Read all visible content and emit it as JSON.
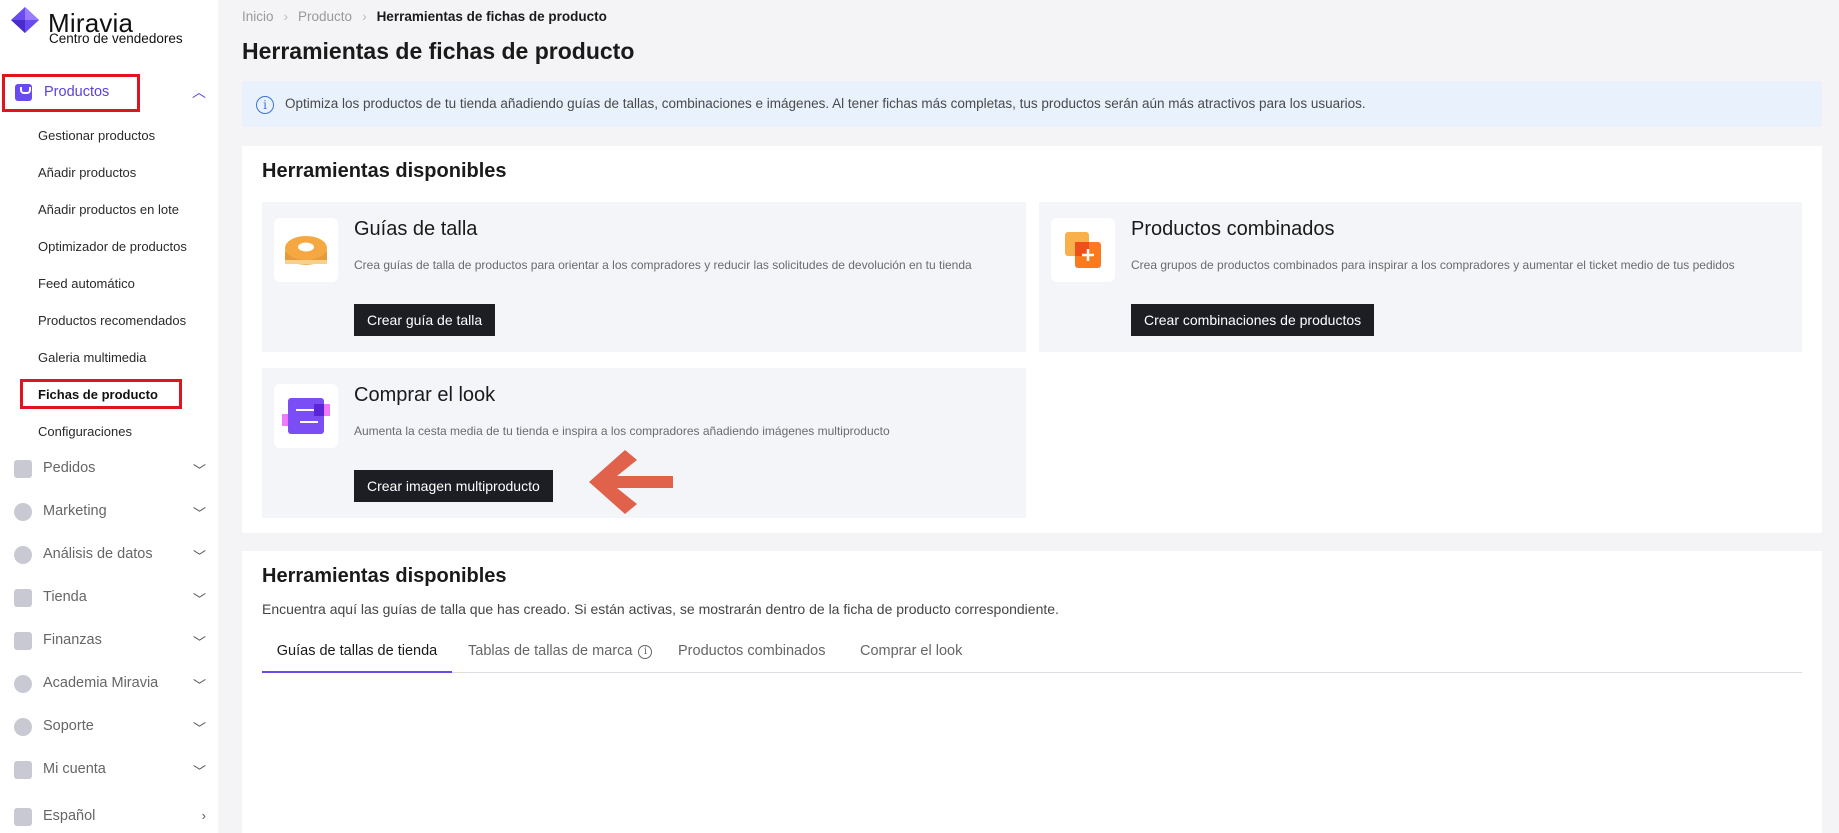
{
  "brand": {
    "name": "Miravia",
    "subtitle": "Centro de vendedores"
  },
  "sidebar": {
    "products": {
      "label": "Productos",
      "icon": "bag-icon"
    },
    "sub_items": [
      "Gestionar productos",
      "Añadir productos",
      "Añadir productos en lote",
      "Optimizador de productos",
      "Feed automático",
      "Productos recomendados",
      "Galeria multimedia",
      "Fichas de producto",
      "Configuraciones"
    ],
    "active_sub_item": "Fichas de producto",
    "sections": [
      {
        "label": "Pedidos",
        "icon": "orders-icon"
      },
      {
        "label": "Marketing",
        "icon": "marketing-icon"
      },
      {
        "label": "Análisis de datos",
        "icon": "chart-icon"
      },
      {
        "label": "Tienda",
        "icon": "store-icon"
      },
      {
        "label": "Finanzas",
        "icon": "wallet-icon"
      },
      {
        "label": "Academia Miravia",
        "icon": "academy-icon"
      },
      {
        "label": "Soporte",
        "icon": "help-icon"
      },
      {
        "label": "Mi cuenta",
        "icon": "user-icon"
      },
      {
        "label": "Español",
        "icon": "globe-icon"
      }
    ]
  },
  "breadcrumb": [
    "Inicio",
    "Producto",
    "Herramientas de fichas de producto"
  ],
  "page_title": "Herramientas de fichas de producto",
  "info_banner": "Optimiza los productos de tu tienda añadiendo guías de tallas, combinaciones e imágenes. Al tener fichas más completas, tus productos serán aún más atractivos para los usuarios.",
  "tools_panel": {
    "title": "Herramientas disponibles",
    "cards": [
      {
        "title": "Guías de talla",
        "description": "Crea guías de talla de productos para orientar a los compradores y reducir las solicitudes de devolución en tu tienda",
        "button": "Crear guía de talla",
        "icon": "measuring-tape-icon"
      },
      {
        "title": "Productos combinados",
        "description": "Crea grupos de productos combinados para inspirar a los compradores y aumentar el ticket medio de tus pedidos",
        "button": "Crear combinaciones de productos",
        "icon": "combined-products-icon"
      },
      {
        "title": "Comprar el look",
        "description": "Aumenta la cesta media de tu tienda e inspira a los compradores añadiendo imágenes multiproducto",
        "button": "Crear imagen multiproducto",
        "icon": "shop-the-look-icon"
      }
    ]
  },
  "list_panel": {
    "title": "Herramientas disponibles",
    "description": "Encuentra aquí las guías de talla que has creado. Si están activas, se mostrarán dentro de la ficha de producto correspondiente.",
    "tabs": [
      "Guías de tallas de tienda",
      "Tablas de tallas de marca",
      "Productos combinados",
      "Comprar el look"
    ],
    "active_tab": "Guías de tallas de tienda"
  },
  "colors": {
    "accent": "#6a4bf0",
    "highlight_border": "#e0141e",
    "annotation_arrow": "#e0624a",
    "button_dark": "#1c1e24"
  }
}
